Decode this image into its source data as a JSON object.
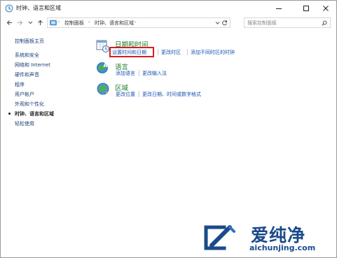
{
  "window": {
    "title": "时钟、语言和区域"
  },
  "address_bar": {
    "crumbs": [
      "控制面板",
      "时钟、语言和区域"
    ],
    "search_placeholder": "搜索控制面板"
  },
  "sidebar": {
    "home": "控制面板主页",
    "items": [
      {
        "label": "系统和安全",
        "current": false
      },
      {
        "label": "网络和 Internet",
        "current": false
      },
      {
        "label": "硬件和声音",
        "current": false
      },
      {
        "label": "程序",
        "current": false
      },
      {
        "label": "用户帐户",
        "current": false
      },
      {
        "label": "外观和个性化",
        "current": false
      },
      {
        "label": "时钟、语言和区域",
        "current": true
      },
      {
        "label": "轻松使用",
        "current": false
      }
    ]
  },
  "categories": [
    {
      "title": "日期和时间",
      "icon": "calendar-clock-icon",
      "links": [
        "设置时间和日期",
        "更改时区",
        "添加不同时区的时钟"
      ]
    },
    {
      "title": "语言",
      "icon": "language-globe-icon",
      "links": [
        "添加语言",
        "更改输入法"
      ]
    },
    {
      "title": "区域",
      "icon": "region-globe-icon",
      "links": [
        "更改位置",
        "更改日期、时间或数字格式"
      ]
    }
  ],
  "highlighted_link": "设置时间和日期",
  "watermark": {
    "name": "爱纯净",
    "url": "aichunjing.com"
  },
  "colors": {
    "category_title": "#1b7c28",
    "link": "#1a52b0",
    "sidebar_link": "#1c3f75",
    "highlight_border": "#d22020",
    "watermark": "#1a4a8a"
  }
}
